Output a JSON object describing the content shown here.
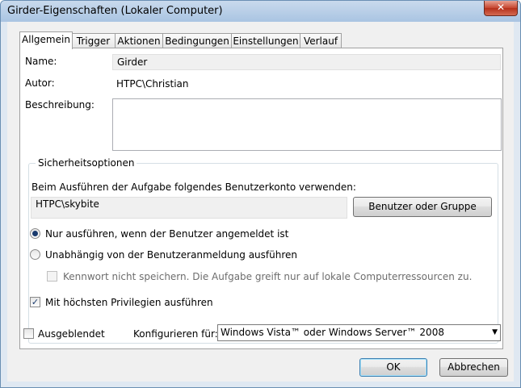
{
  "window": {
    "title": "Girder-Eigenschaften (Lokaler Computer)",
    "close_label": "✕"
  },
  "tabs": [
    {
      "label": "Allgemein"
    },
    {
      "label": "Trigger"
    },
    {
      "label": "Aktionen"
    },
    {
      "label": "Bedingungen"
    },
    {
      "label": "Einstellungen"
    },
    {
      "label": "Verlauf"
    }
  ],
  "general": {
    "name_label": "Name:",
    "name_value": "Girder",
    "author_label": "Autor:",
    "author_value": "HTPC\\Christian",
    "description_label": "Beschreibung:",
    "description_value": ""
  },
  "security": {
    "group_title": "Sicherheitsoptionen",
    "account_prompt": "Beim Ausführen der Aufgabe folgendes Benutzerkonto verwenden:",
    "account_value": "HTPC\\skybite",
    "user_group_button": "Benutzer oder Gruppe",
    "radio_logged_on": "Nur ausführen, wenn der Benutzer angemeldet ist",
    "radio_independent": "Unabhängig von der Benutzeranmeldung ausführen",
    "no_password_label": "Kennwort nicht speichern. Die Aufgabe greift nur auf lokale Computerressourcen zu.",
    "highest_privileges_label": "Mit höchsten Privilegien ausführen",
    "selected_radio": "logged_on",
    "highest_privileges_checked": true
  },
  "footer": {
    "hidden_label": "Ausgeblendet",
    "configure_label": "Konfigurieren für:",
    "configure_value": "Windows Vista™ oder Windows Server™ 2008",
    "ok_label": "OK",
    "cancel_label": "Abbrechen"
  }
}
